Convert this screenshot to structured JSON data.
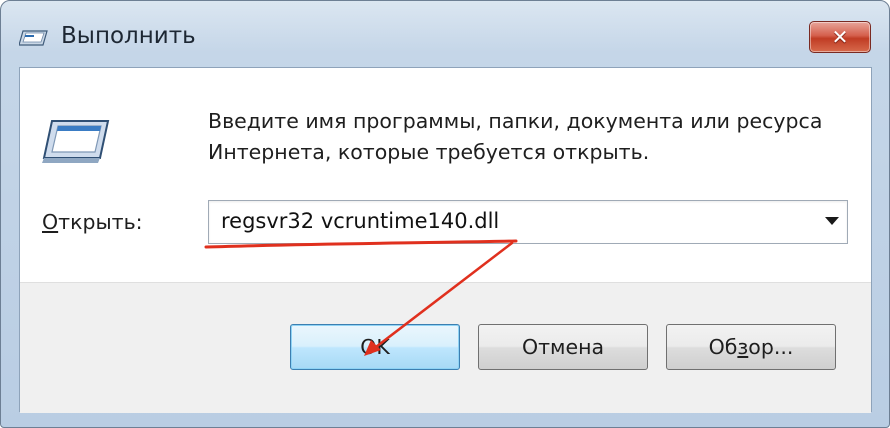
{
  "window": {
    "title": "Выполнить",
    "close_symbol": "✕"
  },
  "dialog": {
    "icon": "run-icon",
    "prompt_line1": "Введите имя программы, папки, документа или ресурса",
    "prompt_line2": "Интернета, которые требуется открыть.",
    "open_label_mnemonic": "О",
    "open_label_rest": "ткрыть:",
    "command_value": "regsvr32 vcruntime140.dll"
  },
  "buttons": {
    "ok": "OK",
    "cancel": "Отмена",
    "browse_pre": "Об",
    "browse_mnemonic": "з",
    "browse_post": "ор..."
  },
  "annotation": {
    "color": "#e0301e"
  }
}
